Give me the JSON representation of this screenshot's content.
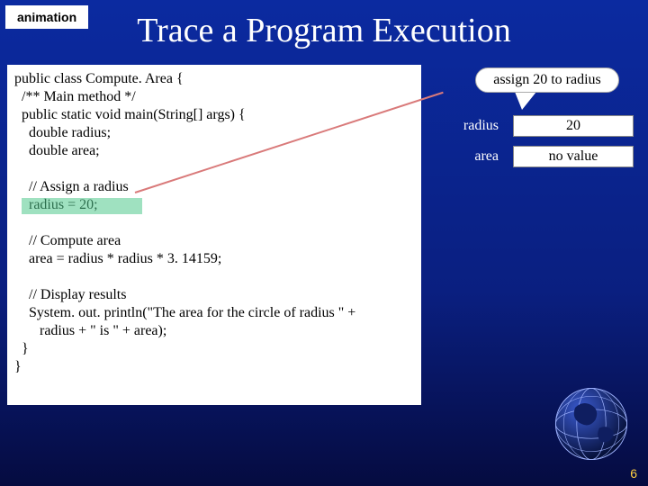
{
  "badge": "animation",
  "title": "Trace a Program Execution",
  "code_lines": [
    "public class Compute. Area {",
    "  /** Main method */",
    "  public static void main(String[] args) {",
    "    double radius;",
    "    double area;",
    "",
    "    // Assign a radius",
    "    radius = 20;",
    "",
    "    // Compute area",
    "    area = radius * radius * 3. 14159;",
    "",
    "    // Display results",
    "    System. out. println(\"The area for the circle of radius \" +",
    "       radius + \" is \" + area);",
    "  }",
    "}"
  ],
  "callout": "assign 20 to radius",
  "variables": [
    {
      "name": "radius",
      "value": "20"
    },
    {
      "name": "area",
      "value": "no value"
    }
  ],
  "slide_number": "6",
  "colors": {
    "callout_bg": "#ffffff",
    "highlight": "rgba(80,200,140,0.55)",
    "pointer": "#d97a7a"
  }
}
